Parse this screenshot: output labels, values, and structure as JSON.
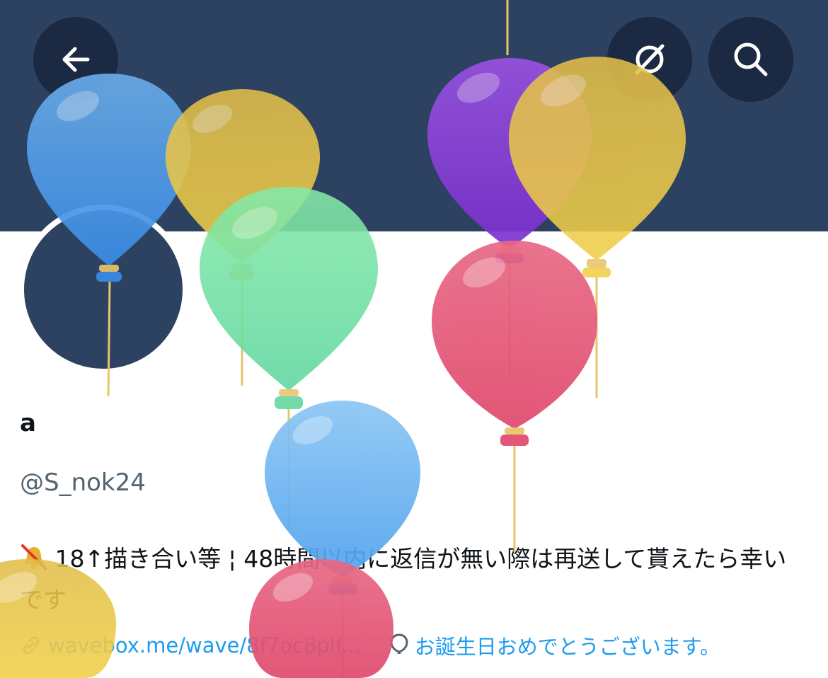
{
  "profile": {
    "display_name": "a",
    "handle": "@S_nok24",
    "bio_icon": "muted-bell-icon",
    "bio_text": "18↑描き合い等 ¦ 48時間以内に返信が無い際は再送して貰えたら幸いです",
    "link_text": "wavebox.me/wave/8f7oc8plf...",
    "birthday_text": "お誕生日おめでとうございます。"
  },
  "header": {
    "back_icon": "arrow-left-icon",
    "mute_icon": "ghost-icon",
    "search_icon": "search-icon"
  },
  "colors": {
    "banner": "#2d4161",
    "button_bg": "#1b2942",
    "link": "#1d9bf0",
    "handle": "#536471"
  }
}
